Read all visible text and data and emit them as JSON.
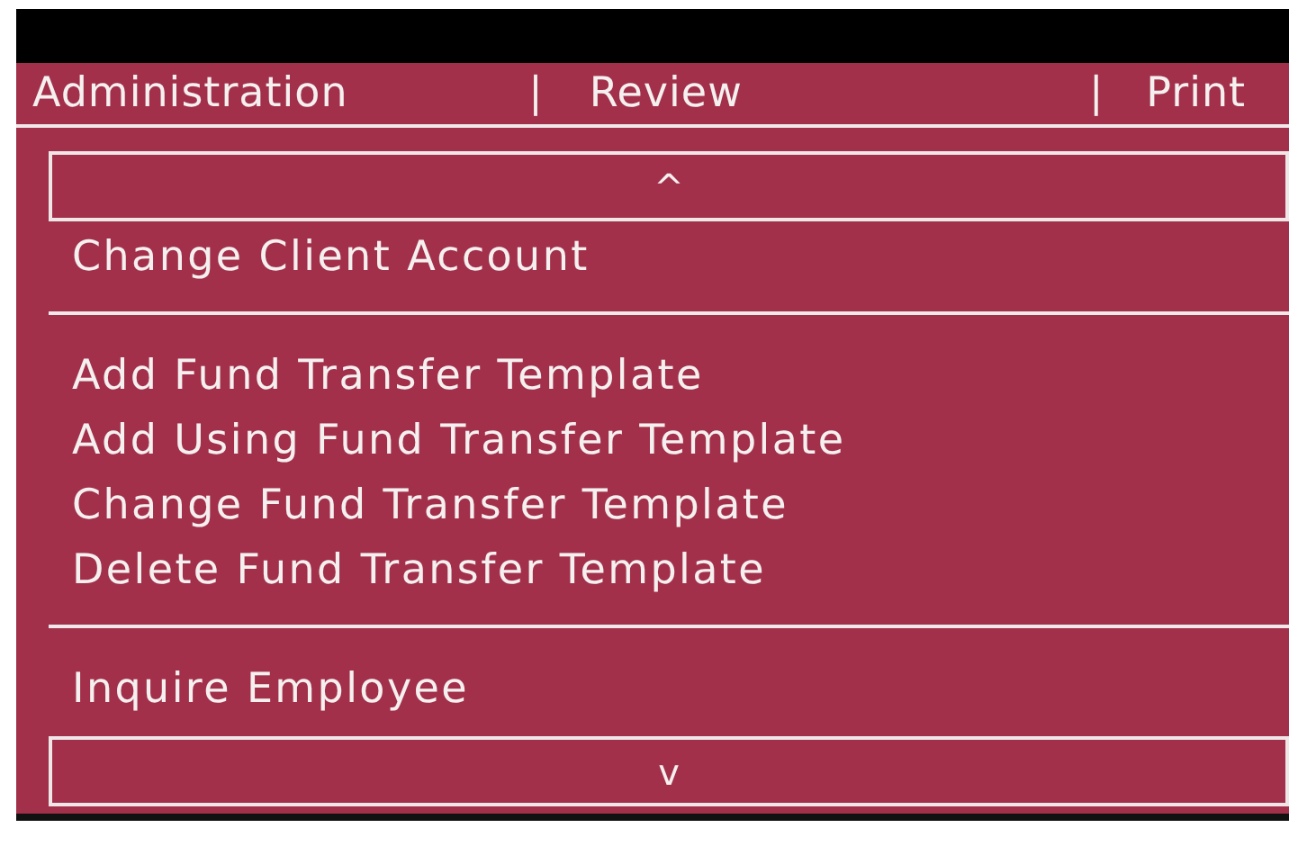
{
  "menu_bar": [
    {
      "kind": "item",
      "label": "Administration"
    },
    {
      "kind": "separator",
      "label": "|"
    },
    {
      "kind": "item",
      "label": "Review"
    },
    {
      "kind": "separator",
      "label": "|"
    },
    {
      "kind": "item",
      "label": "Print"
    }
  ],
  "scroll_up": "^",
  "groups": [
    {
      "items": [
        "Change Client Account"
      ]
    },
    {
      "items": [
        "Add Fund Transfer Template",
        "Add Using Fund Transfer Template",
        "Change Fund Transfer Template",
        "Delete Fund Transfer Template"
      ]
    },
    {
      "items": [
        "Inquire Employee"
      ]
    }
  ],
  "scroll_down": "v"
}
